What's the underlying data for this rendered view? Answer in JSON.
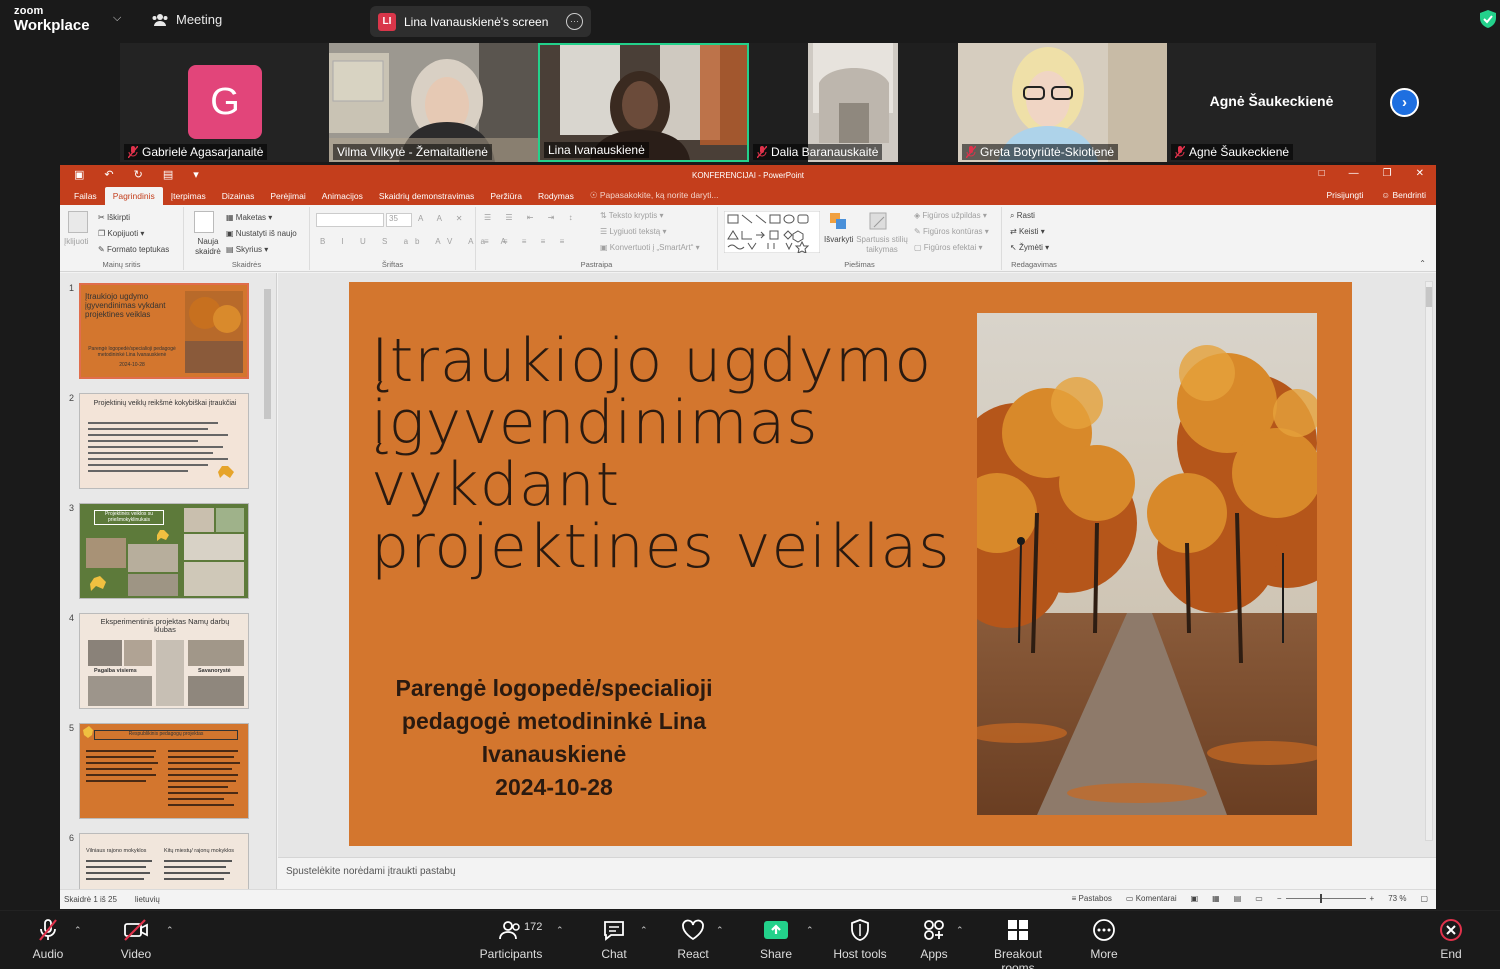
{
  "zoom": {
    "logo_line1": "zoom",
    "logo_line2": "Workplace",
    "meeting_label": "Meeting",
    "share_badge": "LI",
    "share_label": "Lina Ivanauskienė's screen",
    "share_more": "···",
    "colors": {
      "accent_green": "#23d18b",
      "accent_blue": "#1e6fe0",
      "avatar_pink": "#e2457a",
      "danger": "#e0324b"
    }
  },
  "participants": [
    {
      "name": "Gabrielė Agasarjanaitė",
      "avatar": "G",
      "muted": true
    },
    {
      "name": "Vilma Vilkytė - Žemaitaitienė",
      "muted": false
    },
    {
      "name": "Lina Ivanauskienė",
      "muted": false,
      "active": true
    },
    {
      "name": "Dalia Baranauskaitė",
      "muted": true
    },
    {
      "name": "Greta Botyriūtė-Skiotienė",
      "muted": true
    },
    {
      "name": "Agnė Šaukeckienė",
      "display_text": "Agnė Šaukeckienė",
      "muted": true
    }
  ],
  "ppt": {
    "window_title": "KONFERENCIJAI - PowerPoint",
    "tabs": [
      "Failas",
      "Pagrindinis",
      "Įterpimas",
      "Dizainas",
      "Perėjimai",
      "Animacijos",
      "Skaidrių demonstravimas",
      "Peržiūra",
      "Rodymas"
    ],
    "tell_me": "Papasakokite, ką norite daryti...",
    "sign_in": "Prisijungti",
    "share": "Bendrinti",
    "ribbon": {
      "clipboard": {
        "paste": "Įklijuoti",
        "cut": "Iškirpti",
        "copy": "Kopijuoti",
        "format_painter": "Formato teptukas",
        "label": "Mainų sritis"
      },
      "slides": {
        "new_slide": "Nauja skaidrė",
        "layout": "Maketas",
        "reset": "Nustatyti iš naujo",
        "section": "Skyrius",
        "label": "Skaidrės"
      },
      "font": {
        "size": "35",
        "label": "Šriftas"
      },
      "paragraph": {
        "text_direction": "Teksto kryptis",
        "align_text": "Lygiuoti tekstą",
        "convert": "Konvertuoti į „SmartArt“",
        "label": "Pastraipa"
      },
      "drawing": {
        "arrange": "Išvarkyti",
        "quick_styles": "Spartusis stilių taikymas",
        "fill": "Figūros užpildas",
        "outline": "Figūros kontūras",
        "effects": "Figūros efektai",
        "label": "Piešimas"
      },
      "editing": {
        "find": "Rasti",
        "replace": "Keisti",
        "select": "Žymėti",
        "label": "Redagavimas"
      }
    },
    "thumbnails": [
      {
        "num": "1",
        "title": "Įtraukiojo ugdymo įgyvendinimas vykdant projektines veiklas",
        "subtitle": "Parengė logopedė/specialioji pedagogė metodininkė Lina Ivanauskienė",
        "date": "2024-10-28"
      },
      {
        "num": "2",
        "title": "Projektinių veiklų reikšmė kokybiškai įtraukčiai"
      },
      {
        "num": "3",
        "title": "Projektinės veiklos su priešmokyklinukais"
      },
      {
        "num": "4",
        "title": "Eksperimentinis projektas Namų darbų klubas",
        "cap1": "Pagalba visiems",
        "cap2": "Savanorystė"
      },
      {
        "num": "5",
        "title": "Respublikinis pedagogų projektas"
      },
      {
        "num": "6",
        "col1": "Vilniaus rajono mokyklos",
        "col2": "Kitų miestų/ rajonų mokyklos"
      }
    ],
    "slide": {
      "title": "Įtraukiojo ugdymo įgyvendinimas vykdant projektines veiklas",
      "author_l1": "Parengė logopedė/specialioji",
      "author_l2": "pedagogė metodininkė Lina",
      "author_l3": "Ivanauskienė",
      "date": "2024-10-28",
      "bg_color": "#d3762e"
    },
    "notes_placeholder": "Spustelėkite norėdami įtraukti pastabų",
    "status": {
      "slide_of": "Skaidrė 1 iš 25",
      "language": "lietuvių",
      "notes": "Pastabos",
      "comments": "Komentarai",
      "zoom": "73 %"
    }
  },
  "toolbar": {
    "audio": "Audio",
    "video": "Video",
    "participants": "Participants",
    "participants_count": "172",
    "chat": "Chat",
    "react": "React",
    "share": "Share",
    "host_tools": "Host tools",
    "apps": "Apps",
    "breakout": "Breakout rooms",
    "more": "More",
    "end": "End"
  }
}
